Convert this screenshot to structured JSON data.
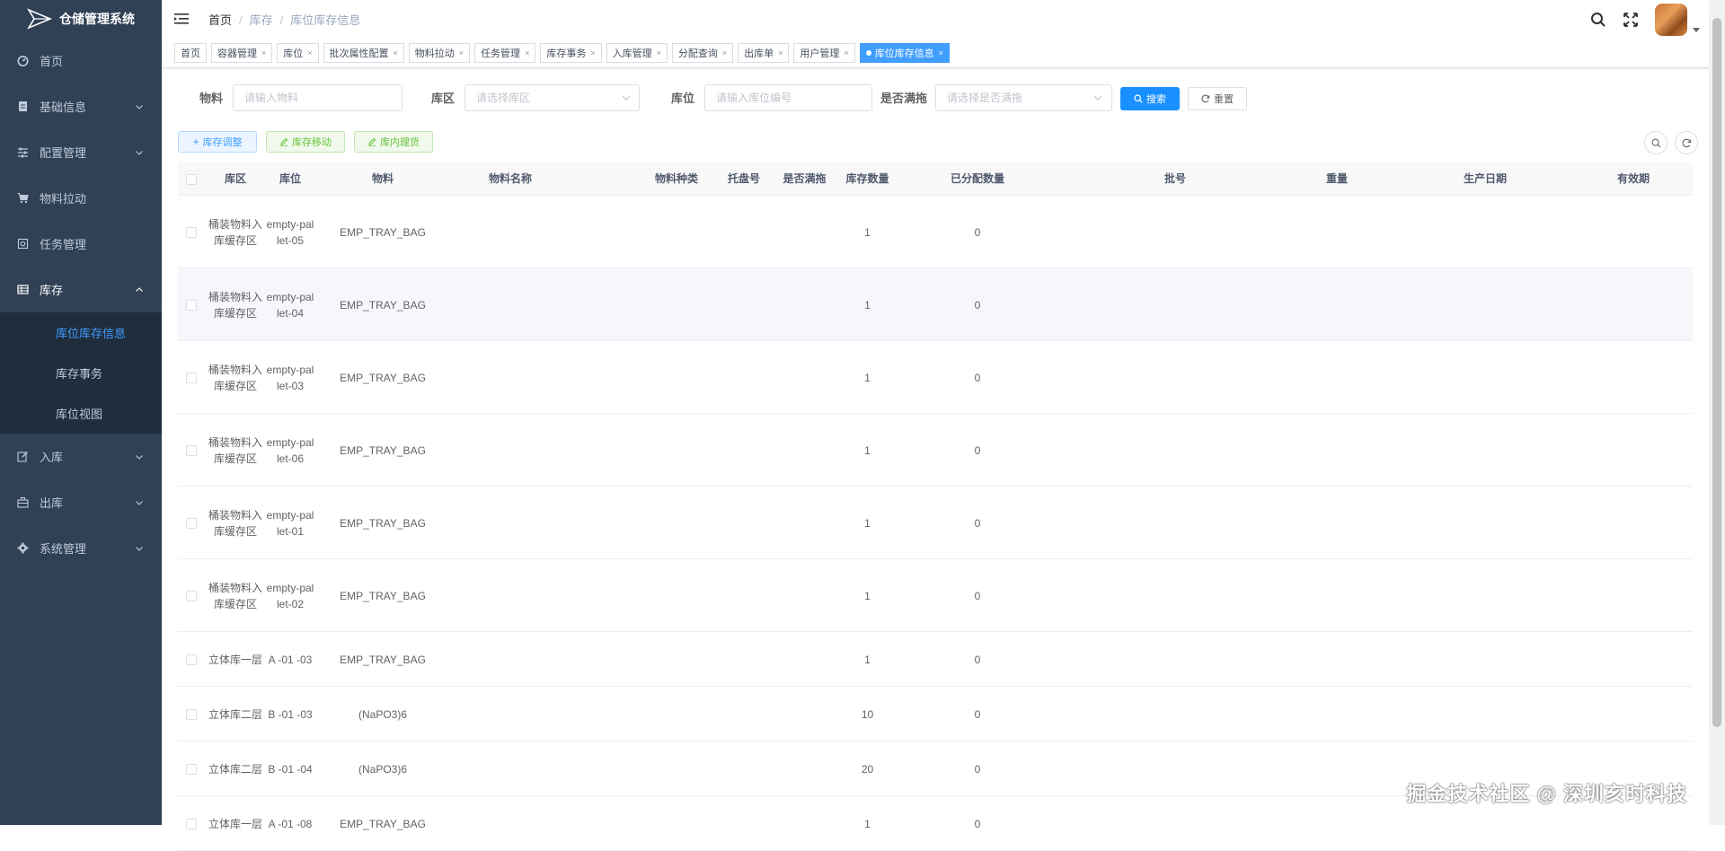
{
  "app": {
    "title": "仓储管理系统"
  },
  "sidebar": {
    "items": [
      {
        "label": "首页",
        "icon": "dashboard-icon"
      },
      {
        "label": "基础信息",
        "icon": "document-icon",
        "arrow": true
      },
      {
        "label": "配置管理",
        "icon": "sliders-icon",
        "arrow": true
      },
      {
        "label": "物料拉动",
        "icon": "cart-icon"
      },
      {
        "label": "任务管理",
        "icon": "task-icon"
      },
      {
        "label": "库存",
        "icon": "grid-icon",
        "arrow": true,
        "open": true
      },
      {
        "label": "入库",
        "icon": "edit-icon",
        "arrow": true
      },
      {
        "label": "出库",
        "icon": "briefcase-icon",
        "arrow": true
      },
      {
        "label": "系统管理",
        "icon": "gear-icon",
        "arrow": true
      }
    ],
    "inventory_sub": [
      {
        "label": "库位库存信息",
        "active": true
      },
      {
        "label": "库存事务"
      },
      {
        "label": "库位视图"
      }
    ]
  },
  "breadcrumb": {
    "home": "首页",
    "level1": "库存",
    "current": "库位库存信息"
  },
  "tags": [
    "首页",
    "容器管理",
    "库位",
    "批次属性配置",
    "物料拉动",
    "任务管理",
    "库存事务",
    "入库管理",
    "分配查询",
    "出库单",
    "用户管理",
    "库位库存信息"
  ],
  "search": {
    "material_label": "物料",
    "material_placeholder": "请输入物料",
    "zone_label": "库区",
    "zone_placeholder": "请选择库区",
    "location_label": "库位",
    "location_placeholder": "请输入库位编号",
    "full_label": "是否满拖",
    "full_placeholder": "请选择是否满拖",
    "search_btn": "搜索",
    "reset_btn": "重置"
  },
  "actions": {
    "adjust": "库存调整",
    "move": "库存移动",
    "pick": "库内理货"
  },
  "table": {
    "headers": {
      "zone": "库区",
      "location": "库位",
      "material": "物料",
      "material_name": "物料名称",
      "material_type": "物料种类",
      "pallet": "托盘号",
      "full": "是否满拖",
      "qty": "库存数量",
      "allocated": "已分配数量",
      "batch": "批号",
      "weight": "重量",
      "prod_date": "生产日期",
      "expiry": "有效期"
    },
    "rows": [
      {
        "zone": "桶装物料入库缓存区",
        "location": "empty-pallet-05",
        "material": "EMP_TRAY_BAG",
        "qty": "1",
        "allocated": "0"
      },
      {
        "zone": "桶装物料入库缓存区",
        "location": "empty-pallet-04",
        "material": "EMP_TRAY_BAG",
        "qty": "1",
        "allocated": "0"
      },
      {
        "zone": "桶装物料入库缓存区",
        "location": "empty-pallet-03",
        "material": "EMP_TRAY_BAG",
        "qty": "1",
        "allocated": "0"
      },
      {
        "zone": "桶装物料入库缓存区",
        "location": "empty-pallet-06",
        "material": "EMP_TRAY_BAG",
        "qty": "1",
        "allocated": "0"
      },
      {
        "zone": "桶装物料入库缓存区",
        "location": "empty-pallet-01",
        "material": "EMP_TRAY_BAG",
        "qty": "1",
        "allocated": "0"
      },
      {
        "zone": "桶装物料入库缓存区",
        "location": "empty-pallet-02",
        "material": "EMP_TRAY_BAG",
        "qty": "1",
        "allocated": "0"
      },
      {
        "zone": "立体库一层",
        "location": "A -01 -03",
        "material": "EMP_TRAY_BAG",
        "qty": "1",
        "allocated": "0"
      },
      {
        "zone": "立体库二层",
        "location": "B -01 -03",
        "material": "(NaPO3)6",
        "qty": "10",
        "allocated": "0"
      },
      {
        "zone": "立体库二层",
        "location": "B -01 -04",
        "material": "(NaPO3)6",
        "qty": "20",
        "allocated": "0"
      },
      {
        "zone": "立体库一层",
        "location": "A -01 -08",
        "material": "EMP_TRAY_BAG",
        "qty": "1",
        "allocated": "0"
      }
    ]
  },
  "watermark": "掘金技术社区 @ 深圳亥时科技",
  "colors": {
    "sidebar_bg": "#304156",
    "submenu_bg": "#1f2d3d",
    "primary": "#1890ff",
    "active_tag": "#409eff"
  }
}
